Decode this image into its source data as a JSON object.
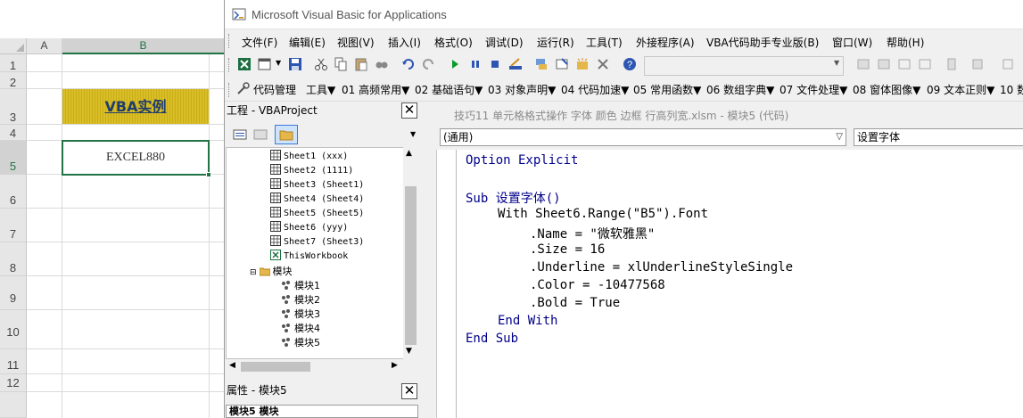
{
  "excel": {
    "columns": [
      "A",
      "B"
    ],
    "rows": [
      "1",
      "2",
      "3",
      "4",
      "5",
      "6",
      "7",
      "8",
      "9",
      "10",
      "11",
      "12"
    ],
    "cell_b3": "VBA实例",
    "cell_b5": "EXCEL880"
  },
  "vbe": {
    "title": "Microsoft Visual Basic for Applications",
    "menu": [
      "文件(F)",
      "编辑(E)",
      "视图(V)",
      "插入(I)",
      "格式(O)",
      "调试(D)",
      "运行(R)",
      "工具(T)",
      "外接程序(A)",
      "VBA代码助手专业版(B)",
      "窗口(W)",
      "帮助(H)"
    ],
    "toolbar2": [
      "代码管理",
      "工具▼",
      "01 高频常用▼",
      "02 基础语句▼",
      "03 对象声明▼",
      "04 代码加速▼",
      "05 常用函数▼",
      "06 数组字典▼",
      "07 文件处理▼",
      "08 窗体图像▼",
      "09 文本正则▼",
      "10 数"
    ],
    "project_title": "工程 - VBAProject",
    "tree": [
      "Sheet1 (xxx)",
      "Sheet2 (1111)",
      "Sheet3 (Sheet1)",
      "Sheet4 (Sheet4)",
      "Sheet5 (Sheet5)",
      "Sheet6 (yyy)",
      "Sheet7 (Sheet3)",
      "ThisWorkbook",
      "模块",
      "模块1",
      "模块2",
      "模块3",
      "模块4",
      "模块5"
    ],
    "props_title": "属性 - 模块5",
    "props_combo": "模块5 模块",
    "code_title": "技巧11 单元格格式操作 字体 颜色 边框 行高列宽.xlsm - 模块5 (代码)",
    "object_combo": "(通用)",
    "proc_combo": "设置字体",
    "code": {
      "l1": "Option Explicit",
      "l2": "Sub 设置字体()",
      "l3": "With Sheet6.Range(\"B5\").Font",
      "l4": ".Name = \"微软雅黑\"",
      "l5": ".Size = 16",
      "l6": ".Underline = xlUnderlineStyleSingle",
      "l7": ".Color = -10477568",
      "l8": ".Bold = True",
      "l9": "End With",
      "l10": "End Sub"
    }
  },
  "colors": {
    "accent_green": "#217346",
    "cell_gold": "#d4b81e",
    "keyword_blue": "#00008b"
  },
  "icons": [
    "excel-icon",
    "view-object-icon",
    "save-icon",
    "cut-icon",
    "copy-icon",
    "paste-icon",
    "find-icon",
    "undo-icon",
    "redo-icon",
    "run-icon",
    "pause-icon",
    "stop-icon",
    "design-mode-icon",
    "project-explorer-icon",
    "properties-icon",
    "object-browser-icon",
    "toolbox-icon",
    "help-icon",
    "folder-icon",
    "module-icon",
    "sheet-icon",
    "workbook-icon"
  ]
}
